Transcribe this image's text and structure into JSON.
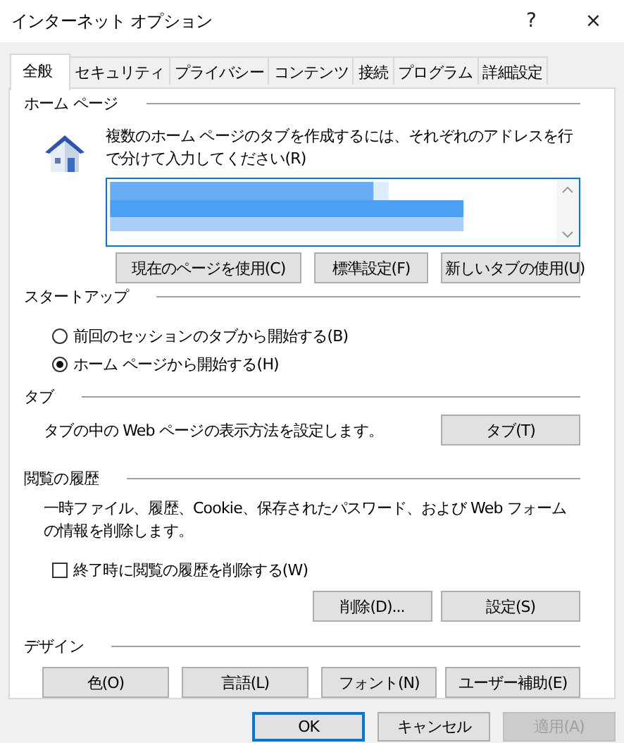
{
  "window": {
    "title": "インターネット オプション",
    "help": "?",
    "close": "×"
  },
  "tabs": [
    {
      "label": "全般",
      "selected": true
    },
    {
      "label": "セキュリティ",
      "selected": false
    },
    {
      "label": "プライバシー",
      "selected": false
    },
    {
      "label": "コンテンツ",
      "selected": false
    },
    {
      "label": "接続",
      "selected": false
    },
    {
      "label": "プログラム",
      "selected": false
    },
    {
      "label": "詳細設定",
      "selected": false
    }
  ],
  "home_page": {
    "heading": "ホーム ページ",
    "description": "複数のホーム ページのタブを作成するには、それぞれのアドレスを行で分けて入力してください(R)",
    "buttons": [
      "現在のページを使用(C)",
      "標準設定(F)",
      "新しいタブの使用(U)"
    ]
  },
  "startup": {
    "heading": "スタートアップ",
    "options": [
      {
        "label": "前回のセッションのタブから開始する(B)",
        "selected": false
      },
      {
        "label": "ホーム ページから開始する(H)",
        "selected": true
      }
    ]
  },
  "tabs_section": {
    "heading": "タブ",
    "description": "タブの中の Web ページの表示方法を設定します。",
    "button": "タブ(T)"
  },
  "history": {
    "heading": "閲覧の履歴",
    "description": "一時ファイル、履歴、Cookie、保存されたパスワード、および Web フォームの情報を削除します。",
    "checkbox": {
      "label": "終了時に閲覧の履歴を削除する(W)",
      "checked": false
    },
    "buttons": [
      "削除(D)...",
      "設定(S)"
    ]
  },
  "design": {
    "heading": "デザイン",
    "buttons": [
      "色(O)",
      "言語(L)",
      "フォント(N)",
      "ユーザー補助(E)"
    ]
  },
  "footer_buttons": [
    {
      "label": "OK",
      "kind": "default",
      "disabled": false
    },
    {
      "label": "キャンセル",
      "kind": "normal",
      "disabled": false
    },
    {
      "label": "適用(A)",
      "kind": "normal",
      "disabled": true
    }
  ]
}
